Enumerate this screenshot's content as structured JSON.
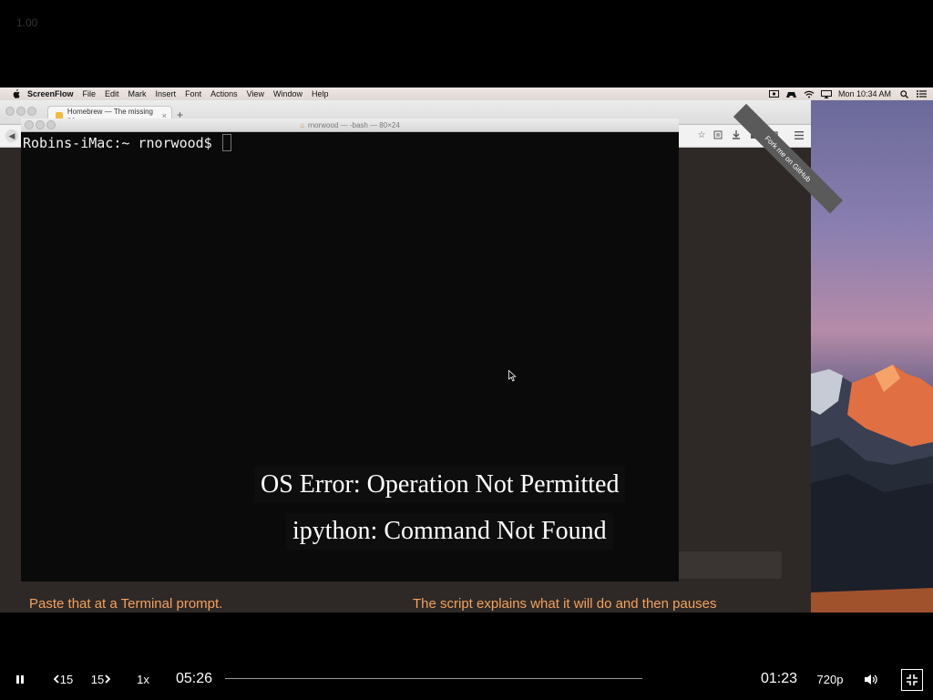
{
  "zoom_label": "1.00",
  "menubar": {
    "app": "ScreenFlow",
    "items": [
      "File",
      "Edit",
      "Mark",
      "Insert",
      "Font",
      "Actions",
      "View",
      "Window",
      "Help"
    ],
    "clock": "Mon 10:34 AM"
  },
  "browser": {
    "tab_title": "Homebrew — The missing pa",
    "tab_close": "×",
    "new_tab": "+",
    "ribbon": "Fork me on GitHub",
    "page_text_left": "Paste that at a Terminal prompt.",
    "page_text_right": "The script explains what it will do and then pauses"
  },
  "terminal": {
    "title": "rnorwood — -bash — 80×24",
    "prompt": "Robins-iMac:~ rnorwood$ "
  },
  "captions": {
    "line1": "OS Error: Operation Not Permitted",
    "line2": "ipython: Command Not Found"
  },
  "player": {
    "skip_back_label": "15",
    "skip_forward_label": "15",
    "speed": "1x",
    "elapsed": "05:26",
    "remaining": "01:23",
    "quality": "720p",
    "progress_fraction": 0.0
  }
}
